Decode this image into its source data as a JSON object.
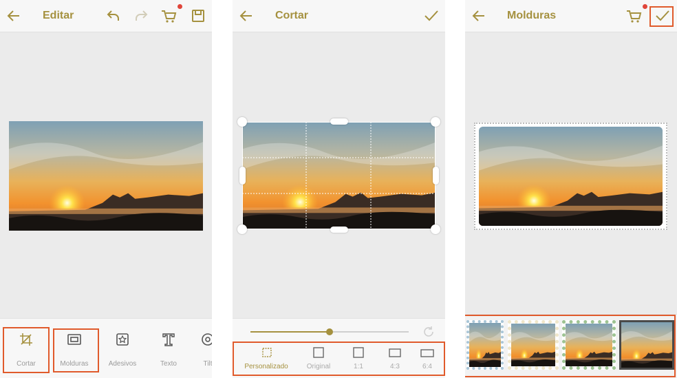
{
  "colors": {
    "accent": "#a5913f",
    "highlight": "#e05a2b",
    "panel_bg": "#ebebeb",
    "bar_bg": "#f7f7f7",
    "badge": "#e0453a"
  },
  "edit_screen": {
    "title": "Editar",
    "icons": [
      "back-arrow-icon",
      "undo-icon",
      "redo-icon",
      "cart-icon",
      "save-icon"
    ],
    "tools": [
      {
        "label": "Cortar",
        "icon": "crop-icon"
      },
      {
        "label": "Molduras",
        "icon": "frame-icon"
      },
      {
        "label": "Adesivos",
        "icon": "sticker-icon"
      },
      {
        "label": "Texto",
        "icon": "text-icon"
      },
      {
        "label": "Tilt",
        "icon": "tilt-icon"
      }
    ]
  },
  "crop_screen": {
    "title": "Cortar",
    "icons": [
      "back-arrow-icon",
      "confirm-check-icon",
      "reset-icon"
    ],
    "rotation_slider": {
      "value": 0.5
    },
    "ratios": [
      {
        "label": "Personalizado",
        "icon": "custom-ratio-icon"
      },
      {
        "label": "Original",
        "icon": "original-ratio-icon"
      },
      {
        "label": "1:1",
        "icon": "ratio-1-1-icon"
      },
      {
        "label": "4:3",
        "icon": "ratio-4-3-icon"
      },
      {
        "label": "6:4",
        "icon": "ratio-6-4-icon"
      }
    ]
  },
  "frames_screen": {
    "title": "Molduras",
    "icons": [
      "back-arrow-icon",
      "cart-icon",
      "confirm-check-icon"
    ],
    "frame_thumbnails": [
      "blue-stamp-frame",
      "beige-stamp-frame",
      "green-stamp-frame",
      "dark-frame"
    ]
  }
}
